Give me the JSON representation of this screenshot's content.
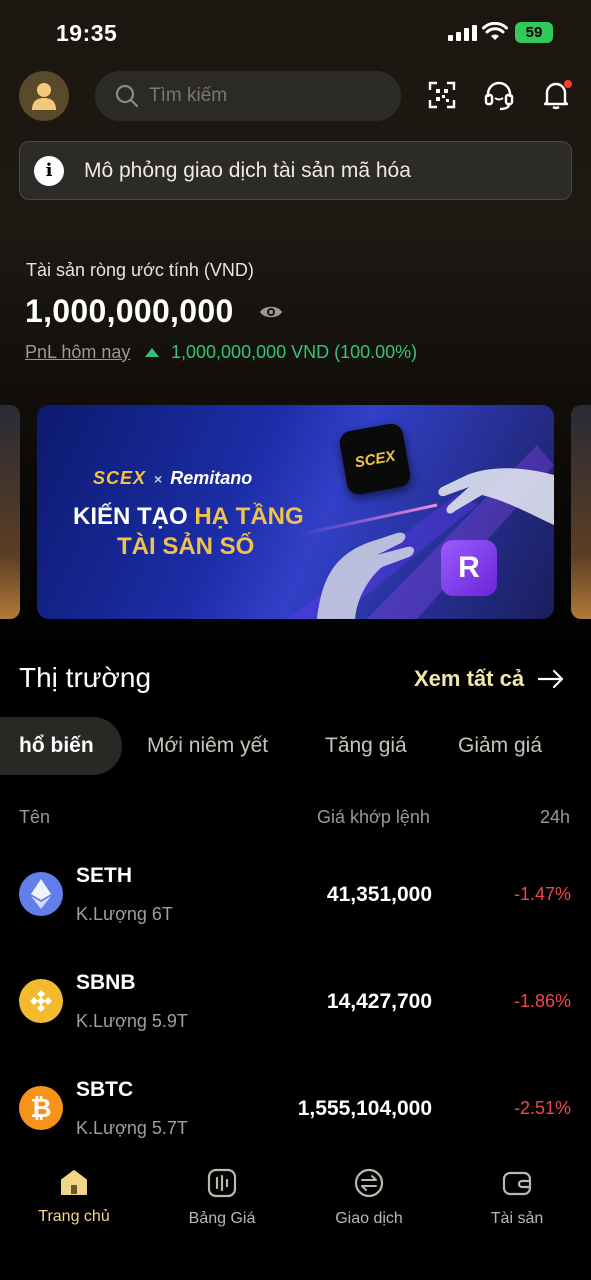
{
  "status_bar": {
    "time": "19:35",
    "battery": "59"
  },
  "header": {
    "search_placeholder": "Tìm kiếm"
  },
  "notice": {
    "text": "Mô phỏng giao dịch tài sản mã hóa"
  },
  "balance": {
    "label": "Tài sản ròng ước tính (VND)",
    "value": "1,000,000,000",
    "pnl_label": "PnL hôm nay",
    "pnl_value": "1,000,000,000 VND (100.00%)"
  },
  "promo": {
    "brand_left": "SCEX",
    "brand_sep": "×",
    "brand_right": "Remitano",
    "line1_a": "KIẾN TẠO ",
    "line1_b": "HẠ TẦNG",
    "line2": "TÀI SẢN SỐ",
    "box_scex": "SCEX",
    "box_r": "R"
  },
  "market": {
    "title": "Thị trường",
    "see_all": "Xem tất cả",
    "tabs": [
      "hổ biến",
      "Mới niêm yết",
      "Tăng giá",
      "Giảm giá"
    ],
    "columns": {
      "name": "Tên",
      "price": "Giá khớp lệnh",
      "change": "24h"
    },
    "rows": [
      {
        "symbol": "SETH",
        "volume": "K.Lượng 6T",
        "price": "41,351,000",
        "change": "-1.47%"
      },
      {
        "symbol": "SBNB",
        "volume": "K.Lượng 5.9T",
        "price": "14,427,700",
        "change": "-1.86%"
      },
      {
        "symbol": "SBTC",
        "volume": "K.Lượng 5.7T",
        "price": "1,555,104,000",
        "change": "-2.51%"
      }
    ]
  },
  "nav": {
    "items": [
      {
        "label": "Trang chủ",
        "icon": "home-icon"
      },
      {
        "label": "Bảng Giá",
        "icon": "price-board-icon"
      },
      {
        "label": "Giao dịch",
        "icon": "exchange-icon"
      },
      {
        "label": "Tài sản",
        "icon": "wallet-icon"
      }
    ]
  },
  "colors": {
    "accent": "#f3d58a",
    "up": "#35c37a",
    "down": "#f0474e"
  }
}
